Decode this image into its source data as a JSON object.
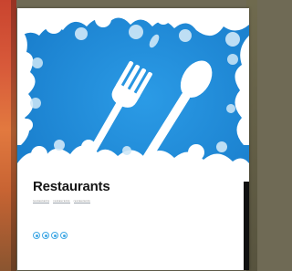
{
  "card": {
    "title": "Restaurants",
    "tags": [
      "restaurants",
      "restaurants",
      "restaurants"
    ],
    "icons": [
      "share-icon",
      "web-icon",
      "play-icon",
      "info-icon"
    ]
  },
  "colors": {
    "sky_blue": "#1f8ede",
    "leaf_light": "#cfe8f8",
    "icon_blue": "#3fa7e4",
    "left_accent": "#d85a3a"
  }
}
